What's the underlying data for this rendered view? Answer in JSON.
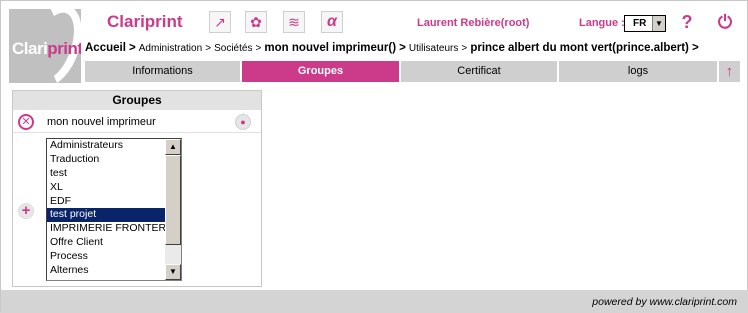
{
  "header": {
    "logo_text_main": "Clari",
    "logo_text_accent": "print",
    "app_title": "Clariprint",
    "tools": [
      {
        "icon": "chart-line-icon",
        "glyph": "↗"
      },
      {
        "icon": "share-nodes-icon",
        "glyph": "✿"
      },
      {
        "icon": "stack-layers-icon",
        "glyph": "≋"
      },
      {
        "icon": "alpha-icon",
        "glyph": "α"
      }
    ],
    "user": "Laurent Rebière(root)",
    "language_label": "Langue :",
    "language_value": "FR",
    "help_glyph": "?",
    "power_glyph": "⏻"
  },
  "breadcrumb": {
    "home": "Accueil",
    "sep": ">",
    "administration": "Administration",
    "societes": "Sociétés",
    "company": "mon nouvel imprimeur()",
    "utilisateurs": "Utilisateurs",
    "user": "prince albert du mont vert(prince.albert)"
  },
  "tabs": [
    {
      "label": "Informations",
      "active": false
    },
    {
      "label": "Groupes",
      "active": true
    },
    {
      "label": "Certificat",
      "active": false
    },
    {
      "label": "logs",
      "active": false
    }
  ],
  "tab_up_glyph": "↑",
  "panel": {
    "title": "Groupes",
    "current_group": "mon nouvel imprimeur",
    "remove_glyph": "✕",
    "dot_glyph": "●",
    "add_glyph": "+",
    "list_items": [
      "Administrateurs",
      "Traduction",
      "test",
      "XL",
      "EDF",
      "test projet",
      "IMPRIMERIE FRONTERE",
      "Offre Client",
      "Process",
      "Alternes"
    ],
    "selected_item": "test projet"
  },
  "footer": {
    "powered_by": "powered by www.clariprint.com"
  },
  "colors": {
    "accent": "#cc3a8a",
    "tab_inactive": "#cfcfcf",
    "selection": "#0a246a"
  }
}
